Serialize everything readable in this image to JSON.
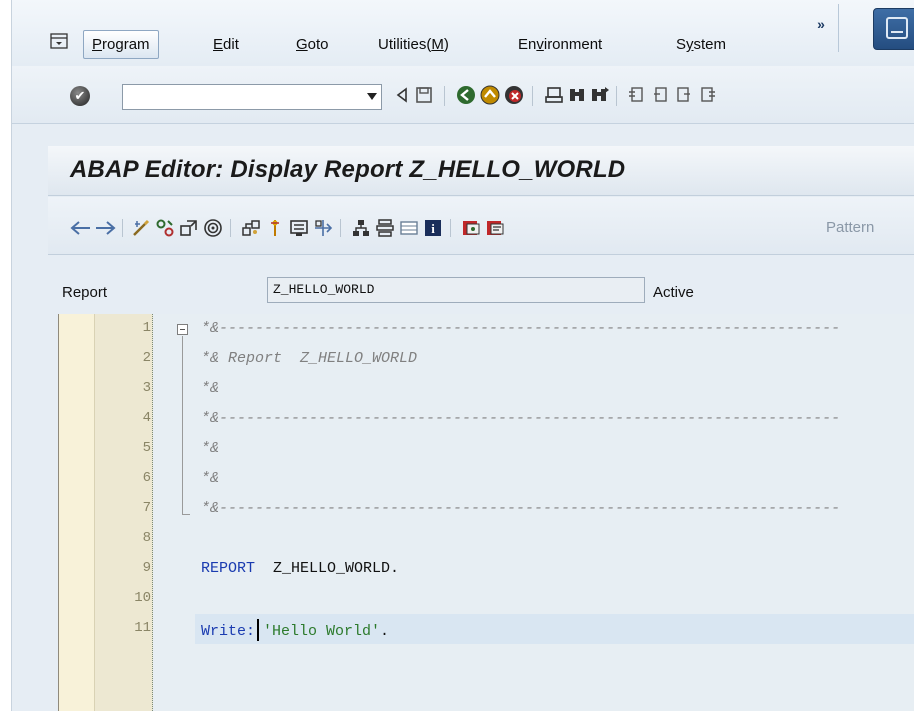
{
  "menu": {
    "items": [
      {
        "label_pre": "",
        "label_u": "P",
        "label_post": "rogram",
        "active": true
      },
      {
        "label_pre": "",
        "label_u": "E",
        "label_post": "dit",
        "active": false
      },
      {
        "label_pre": "",
        "label_u": "G",
        "label_post": "oto",
        "active": false
      },
      {
        "label_pre": "Utilities(",
        "label_u": "M",
        "label_post": ")",
        "active": false
      },
      {
        "label_pre": "En",
        "label_u": "v",
        "label_post": "ironment",
        "active": false
      },
      {
        "label_pre": "S",
        "label_u": "y",
        "label_post": "stem",
        "active": false
      }
    ],
    "more": "»"
  },
  "stdbar": {
    "command_value": "",
    "ok_glyph": "✔"
  },
  "title": "ABAP Editor: Display Report Z_HELLO_WORLD",
  "appbar": {
    "pattern_label": "Pattern"
  },
  "report": {
    "label": "Report",
    "name": "Z_HELLO_WORLD",
    "status": "Active"
  },
  "editor": {
    "lines": [
      {
        "num": "1",
        "text": "*&---------------------------------------------------------------------",
        "kind": "comment"
      },
      {
        "num": "2",
        "text": "*& Report  Z_HELLO_WORLD",
        "kind": "comment"
      },
      {
        "num": "3",
        "text": "*&",
        "kind": "comment"
      },
      {
        "num": "4",
        "text": "*&---------------------------------------------------------------------",
        "kind": "comment"
      },
      {
        "num": "5",
        "text": "*&",
        "kind": "comment"
      },
      {
        "num": "6",
        "text": "*&",
        "kind": "comment"
      },
      {
        "num": "7",
        "text": "*&---------------------------------------------------------------------",
        "kind": "comment"
      },
      {
        "num": "8",
        "text": "",
        "kind": "plain"
      },
      {
        "num": "9",
        "kw": "REPORT",
        "rest": "  Z_HELLO_WORLD.",
        "kind": "report"
      },
      {
        "num": "10",
        "text": "",
        "kind": "plain"
      },
      {
        "num": "11",
        "kw": "Write:",
        "str": "'Hello World'",
        "end": ".",
        "kind": "write"
      }
    ]
  },
  "colors": {
    "keyword": "#1a3bb0",
    "string": "#2c7a2c",
    "comment": "#808080",
    "title_bar": "#1a1a1a"
  }
}
